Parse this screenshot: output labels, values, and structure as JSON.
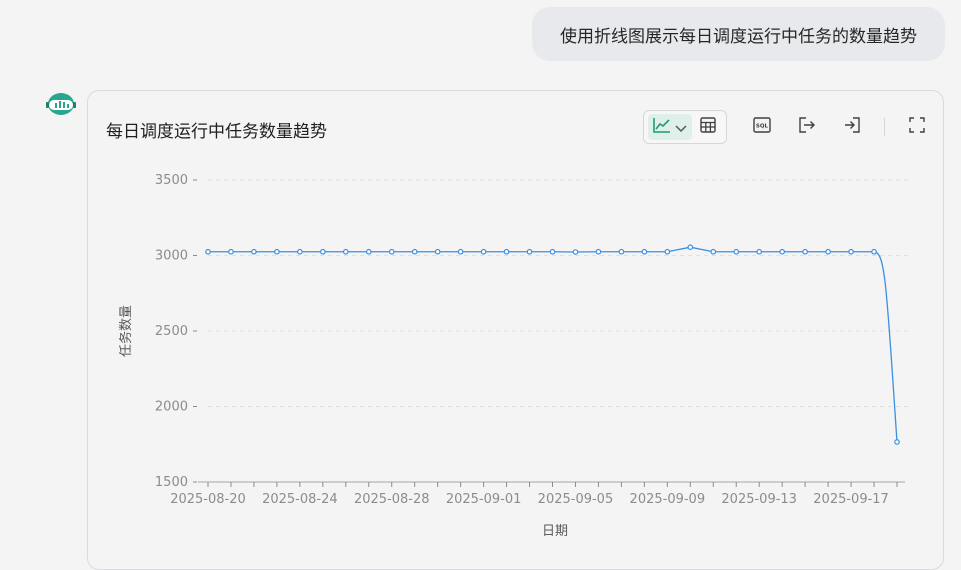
{
  "conversation": {
    "user_message": "使用折线图展示每日调度运行中任务的数量趋势"
  },
  "card": {
    "title": "每日调度运行中任务数量趋势",
    "toolbar": {
      "line_chart_icon": "line-chart-icon",
      "dropdown_icon": "chevron-down-icon",
      "table_icon": "table-icon",
      "sql_icon": "sql-icon",
      "export_icon": "export-icon",
      "import_icon": "import-icon",
      "fullscreen_icon": "fullscreen-icon",
      "accent_color": "#1f9d6e"
    }
  },
  "chart_data": {
    "type": "line",
    "xlabel": "日期",
    "ylabel": "任务数量",
    "ylim": [
      1500,
      3500
    ],
    "yticks": [
      1500,
      2000,
      2500,
      3000,
      3500
    ],
    "grid": true,
    "line_color": "#3b8fe0",
    "x": [
      "2025-08-20",
      "2025-08-21",
      "2025-08-22",
      "2025-08-23",
      "2025-08-24",
      "2025-08-25",
      "2025-08-26",
      "2025-08-27",
      "2025-08-28",
      "2025-08-29",
      "2025-08-30",
      "2025-08-31",
      "2025-09-01",
      "2025-09-02",
      "2025-09-03",
      "2025-09-04",
      "2025-09-05",
      "2025-09-06",
      "2025-09-07",
      "2025-09-08",
      "2025-09-09",
      "2025-09-10",
      "2025-09-11",
      "2025-09-12",
      "2025-09-13",
      "2025-09-14",
      "2025-09-15",
      "2025-09-16",
      "2025-09-17",
      "2025-09-18",
      "2025-09-19"
    ],
    "xtick_labels": [
      "2025-08-20",
      "2025-08-24",
      "2025-08-28",
      "2025-09-01",
      "2025-09-05",
      "2025-09-09",
      "2025-09-13",
      "2025-09-17"
    ],
    "values": [
      3025,
      3025,
      3025,
      3025,
      3025,
      3025,
      3025,
      3025,
      3025,
      3025,
      3025,
      3025,
      3025,
      3025,
      3025,
      3025,
      3023,
      3025,
      3025,
      3025,
      3025,
      3055,
      3025,
      3025,
      3025,
      3025,
      3025,
      3025,
      3025,
      3025,
      1765
    ]
  }
}
